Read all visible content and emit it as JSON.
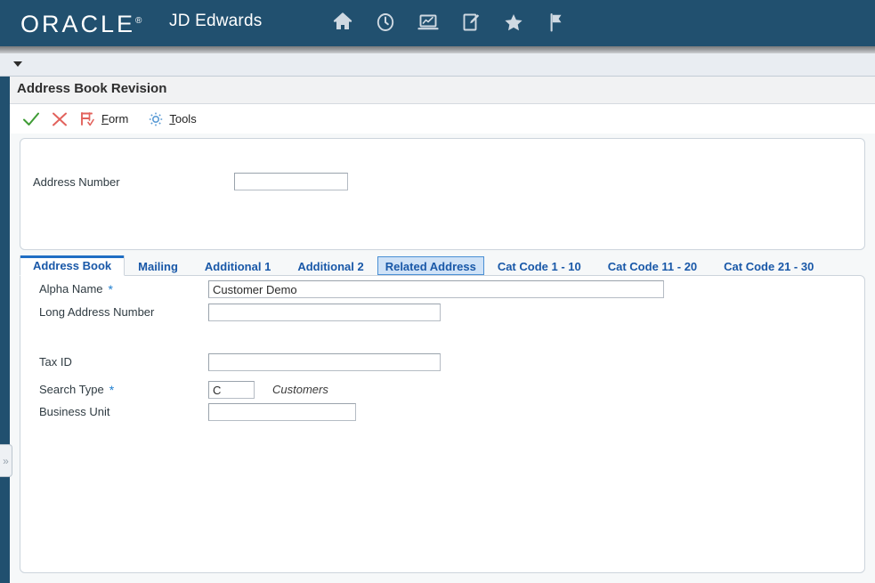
{
  "header": {
    "brand": "ORACLE",
    "brand_mark": "®",
    "product": "JD Edwards",
    "icons": [
      {
        "name": "home-icon",
        "label": "Home"
      },
      {
        "name": "recent-clock-icon",
        "label": "Recent"
      },
      {
        "name": "reports-laptop-icon",
        "label": "Reports"
      },
      {
        "name": "notepad-edit-icon",
        "label": "Notes"
      },
      {
        "name": "favorites-star-icon",
        "label": "Favorites"
      },
      {
        "name": "flag-icon",
        "label": "Flag"
      }
    ]
  },
  "breadcrumb": {
    "caret": "dropdown-caret"
  },
  "page": {
    "title": "Address Book Revision"
  },
  "toolbar": {
    "ok_label": "",
    "ok_icon": "check-icon",
    "cancel_label": "",
    "cancel_icon": "close-x-icon",
    "form_label": "Form",
    "form_accel": "F",
    "form_rest": "orm",
    "tools_label": "Tools",
    "tools_accel": "T",
    "tools_rest": "ools"
  },
  "rail": {
    "expander": "»"
  },
  "header_panel": {
    "address_number": {
      "label": "Address Number",
      "value": "",
      "placeholder": ""
    }
  },
  "tabs": [
    {
      "label": "Address Book",
      "state": "active"
    },
    {
      "label": "Mailing",
      "state": "normal"
    },
    {
      "label": "Additional 1",
      "state": "normal"
    },
    {
      "label": "Additional 2",
      "state": "normal"
    },
    {
      "label": "Related Address",
      "state": "focused"
    },
    {
      "label": "Cat Code 1 - 10",
      "state": "normal"
    },
    {
      "label": "Cat Code 11 - 20",
      "state": "normal"
    },
    {
      "label": "Cat Code 21 - 30",
      "state": "normal"
    }
  ],
  "form": {
    "alpha_name": {
      "label": "Alpha Name",
      "required": "*",
      "value": "Customer Demo",
      "placeholder": ""
    },
    "long_address_number": {
      "label": "Long Address Number",
      "value": "",
      "placeholder": ""
    },
    "tax_id": {
      "label": "Tax ID",
      "value": "",
      "placeholder": ""
    },
    "search_type": {
      "label": "Search Type",
      "required": "*",
      "value": "C",
      "placeholder": "",
      "description": "Customers"
    },
    "business_unit": {
      "label": "Business Unit",
      "value": "",
      "placeholder": ""
    }
  },
  "colors": {
    "header_navy": "#21506f",
    "tab_blue": "#1958a8",
    "active_tab_underline": "#1f6ec4",
    "required_star": "#1f7fd0",
    "ok_green": "#3f9c35",
    "cancel_red": "#e2625c",
    "form_icon_red": "#e2625c",
    "tools_icon_blue": "#5b9bd5"
  }
}
